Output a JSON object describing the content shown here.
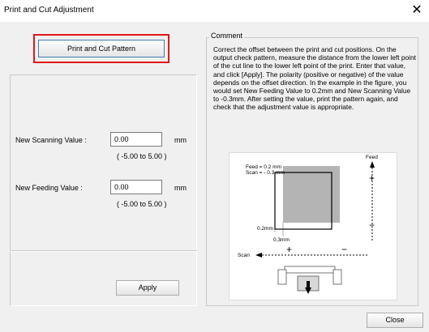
{
  "window": {
    "title": "Print and Cut Adjustment",
    "close_glyph": "✕"
  },
  "pattern_button": {
    "label": "Print and Cut Pattern"
  },
  "scanning": {
    "label": "New Scanning Value :",
    "value": "0.00",
    "unit": "mm",
    "range": "( -5.00  to  5.00 )"
  },
  "feeding": {
    "label": "New Feeding Value :",
    "value": "0.00",
    "unit": "mm",
    "range": "( -5.00  to  5.00 )"
  },
  "apply_button": {
    "label": "Apply"
  },
  "close_button": {
    "label": "Close"
  },
  "comment": {
    "legend": "Comment",
    "text": "Correct the offset between the print and cut positions. On the output check pattern, measure the distance from the lower left point of the cut line to the lower left point of the print. Enter that value, and click [Apply]. The polarity (positive or negative) of the value depends on the offset direction. In the example in the figure, you would set New Feeding Value to 0.2mm and New Scanning Value to -0.3mm. After setting the value, print the pattern again, and check that the adjustment value is appropriate."
  },
  "figure": {
    "feed_note": "Feed = 0.2 mm",
    "scan_note": "Scan = - 0.3 mm",
    "feed_axis": "Feed",
    "scan_axis": "Scan",
    "plus": "+",
    "minus": "−",
    "offset_feed": "0.2mm",
    "offset_scan": "0.3mm"
  },
  "colors": {
    "highlight_border": "#e01818",
    "print_square": "#b4b4b4"
  }
}
